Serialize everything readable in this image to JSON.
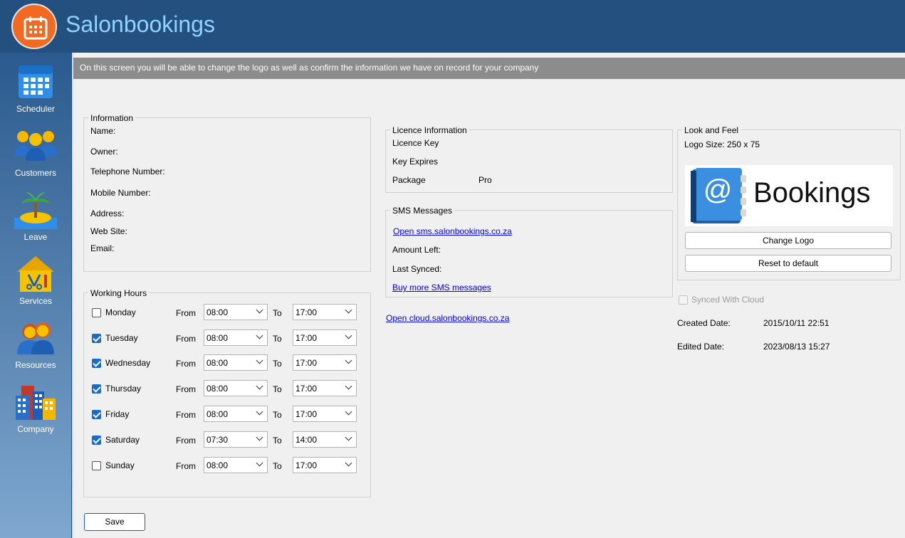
{
  "header": {
    "title": "Salonbookings"
  },
  "sidebar": {
    "items": [
      {
        "label": "Scheduler"
      },
      {
        "label": "Customers"
      },
      {
        "label": "Leave"
      },
      {
        "label": "Services"
      },
      {
        "label": "Resources"
      },
      {
        "label": "Company"
      }
    ]
  },
  "banner": {
    "text": "On this screen you will be able to change the logo as well as confirm the information we have on record for your company"
  },
  "information": {
    "legend": "Information",
    "name_label": "Name:",
    "owner_label": "Owner:",
    "telephone_label": "Telephone Number:",
    "mobile_label": "Mobile Number:",
    "address_label": "Address:",
    "website_label": "Web Site:",
    "email_label": "Email:"
  },
  "working_hours": {
    "legend": "Working Hours",
    "from_label": "From",
    "to_label": "To",
    "days": [
      {
        "day": "Monday",
        "checked": false,
        "from": "08:00",
        "to": "17:00"
      },
      {
        "day": "Tuesday",
        "checked": true,
        "from": "08:00",
        "to": "17:00"
      },
      {
        "day": "Wednesday",
        "checked": true,
        "from": "08:00",
        "to": "17:00"
      },
      {
        "day": "Thursday",
        "checked": true,
        "from": "08:00",
        "to": "17:00"
      },
      {
        "day": "Friday",
        "checked": true,
        "from": "08:00",
        "to": "17:00"
      },
      {
        "day": "Saturday",
        "checked": true,
        "from": "07:30",
        "to": "14:00"
      },
      {
        "day": "Sunday",
        "checked": false,
        "from": "08:00",
        "to": "17:00"
      }
    ]
  },
  "licence": {
    "legend": "Licence Information",
    "key_label": "Licence Key",
    "expires_label": "Key Expires",
    "package_label": "Package",
    "package_value": "Pro"
  },
  "sms": {
    "legend": "SMS Messages",
    "open_link": "Open sms.salonbookings.co.za",
    "amount_label": "Amount Left:",
    "last_synced_label": "Last Synced:",
    "buy_link": "Buy more SMS messages"
  },
  "cloud_link": "Open cloud.salonbookings.co.za",
  "look_feel": {
    "legend": "Look and Feel",
    "logo_size": "Logo Size: 250 x 75",
    "logo_text": "Bookings",
    "change_logo": "Change Logo",
    "reset_default": "Reset to default"
  },
  "sync": {
    "label": "Synced With Cloud",
    "checked": false
  },
  "dates": {
    "created_label": "Created Date:",
    "created_value": "2015/10/11 22:51",
    "edited_label": "Edited Date:",
    "edited_value": "2023/08/13 15:27"
  },
  "save_label": "Save",
  "colors": {
    "header_bg": "#24507f",
    "title_color": "#8fd3ff",
    "logo_orange": "#f26a21",
    "checkbox_blue": "#1a6cc8",
    "link_blue": "#0000ee"
  }
}
